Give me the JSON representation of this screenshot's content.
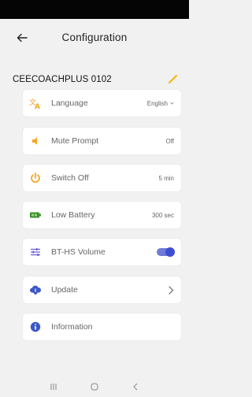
{
  "header": {
    "title": "Configuration",
    "back_icon": "arrow-left-icon"
  },
  "device": {
    "name": "CEECOACHPLUS 0102",
    "edit_icon": "pencil-icon",
    "accent_color": "#f5b800"
  },
  "settings": [
    {
      "label": "Language",
      "value": "English",
      "icon": "translate-icon",
      "control": "dropdown"
    },
    {
      "label": "Mute Prompt",
      "value": "Off",
      "icon": "speaker-icon",
      "control": "value"
    },
    {
      "label": "Switch Off",
      "value": "5 min",
      "icon": "power-icon",
      "control": "value"
    },
    {
      "label": "Low Battery",
      "value": "300 sec",
      "icon": "battery-icon",
      "control": "value"
    },
    {
      "label": "BT-HS Volume",
      "value": "",
      "icon": "equalizer-icon",
      "control": "toggle",
      "toggle_on": true
    },
    {
      "label": "Update",
      "value": "",
      "icon": "cloud-download-icon",
      "control": "chevron"
    },
    {
      "label": "Information",
      "value": "",
      "icon": "info-icon",
      "control": "none"
    }
  ],
  "colors": {
    "orange": "#f5a623",
    "green": "#3e8e33",
    "blue": "#3c58c8",
    "purple": "#6a5bd6"
  },
  "navbar": {
    "items": [
      "recent-apps-icon",
      "home-icon",
      "back-icon"
    ]
  }
}
